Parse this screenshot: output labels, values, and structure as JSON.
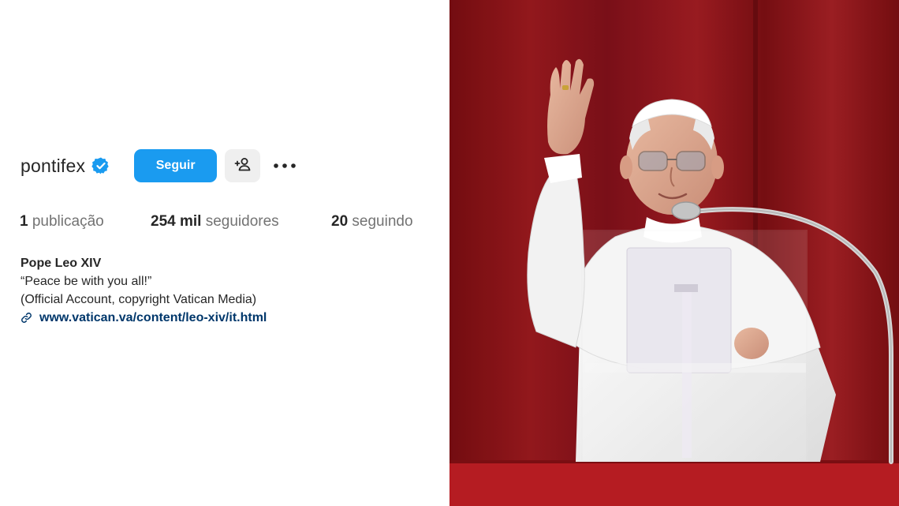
{
  "profile": {
    "username": "pontifex",
    "follow_label": "Seguir",
    "more_label": "•••",
    "stats": {
      "posts_count": "1",
      "posts_label": " publicação",
      "followers_count": "254 mil",
      "followers_label": " seguidores",
      "following_count": "20",
      "following_label": " seguindo"
    },
    "bio": {
      "name": "Pope Leo XIV",
      "line1": "“Peace be with you all!”",
      "line2": "(Official Account, copyright Vatican Media)",
      "link": "www.vatican.va/content/leo-xiv/it.html"
    },
    "icons": {
      "verified": "verified-badge-icon",
      "suggest": "add-person-icon",
      "link": "link-icon"
    }
  },
  "colors": {
    "accent": "#1a9bf0",
    "link": "#00376b",
    "curtain": "#8e1216"
  }
}
